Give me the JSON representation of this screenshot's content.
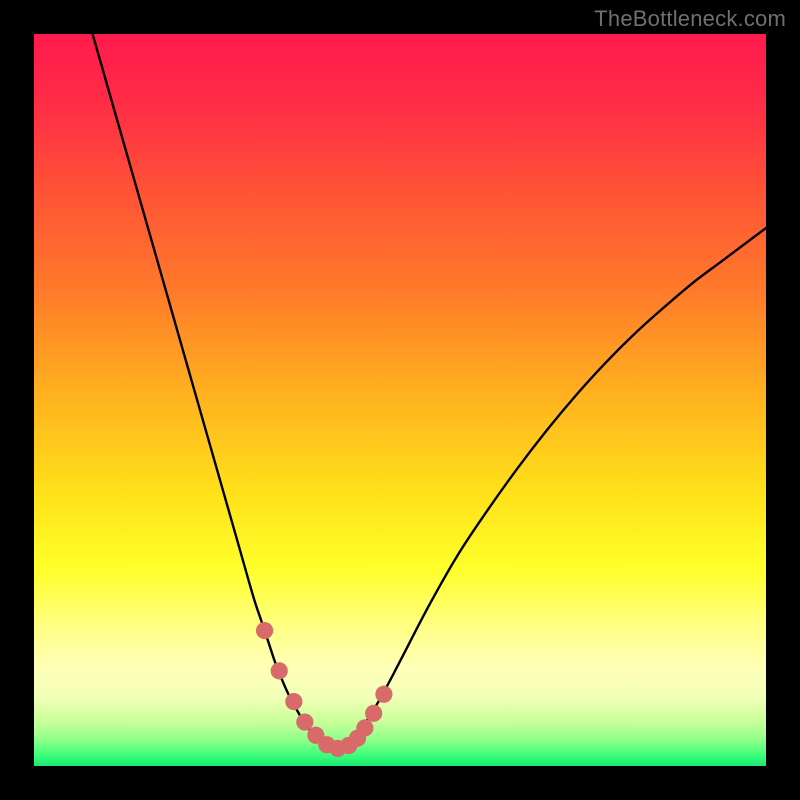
{
  "watermark": "TheBottleneck.com",
  "colors": {
    "bg_black": "#000000",
    "watermark": "#6f6f6f",
    "curve": "#000000",
    "marker_fill": "#d96a6a",
    "marker_stroke": "#c95858",
    "gradient_stops": [
      {
        "offset": 0.0,
        "color": "#ff1a4d"
      },
      {
        "offset": 0.1,
        "color": "#ff2e46"
      },
      {
        "offset": 0.22,
        "color": "#ff5436"
      },
      {
        "offset": 0.35,
        "color": "#ff7a2a"
      },
      {
        "offset": 0.5,
        "color": "#ffb41f"
      },
      {
        "offset": 0.63,
        "color": "#ffe21a"
      },
      {
        "offset": 0.73,
        "color": "#ffff2a"
      },
      {
        "offset": 0.815,
        "color": "#ffff8a"
      },
      {
        "offset": 0.865,
        "color": "#ffffb8"
      },
      {
        "offset": 0.905,
        "color": "#f3ffb8"
      },
      {
        "offset": 0.94,
        "color": "#c8ff9a"
      },
      {
        "offset": 0.965,
        "color": "#8dff8a"
      },
      {
        "offset": 0.985,
        "color": "#3dff7a"
      },
      {
        "offset": 1.0,
        "color": "#16e873"
      }
    ]
  },
  "chart_data": {
    "type": "line",
    "title": "",
    "xlabel": "",
    "ylabel": "",
    "xlim": [
      0,
      100
    ],
    "ylim": [
      0,
      100
    ],
    "series": [
      {
        "name": "bottleneck-curve",
        "x": [
          8,
          10,
          12,
          14,
          16,
          18,
          20,
          22,
          24,
          26,
          28,
          30,
          31,
          32,
          33,
          34,
          35,
          36,
          37,
          38,
          39,
          40,
          41,
          42,
          43,
          44,
          46,
          48,
          50,
          54,
          58,
          62,
          66,
          70,
          74,
          78,
          82,
          86,
          90,
          94,
          98,
          100
        ],
        "y": [
          100,
          93,
          86,
          79,
          72,
          65,
          58,
          51,
          44,
          37,
          30,
          23,
          20,
          17,
          14,
          11.5,
          9.3,
          7.5,
          5.8,
          4.5,
          3.5,
          2.8,
          2.4,
          2.6,
          3.2,
          4.2,
          7.0,
          10.5,
          14.3,
          22.0,
          29.0,
          35.0,
          40.6,
          45.8,
          50.6,
          55.0,
          59.0,
          62.6,
          66.0,
          69.0,
          72.0,
          73.5
        ]
      }
    ],
    "markers": {
      "name": "highlight-points",
      "x": [
        31.5,
        33.5,
        35.5,
        37.0,
        38.5,
        40.0,
        41.5,
        43.0,
        44.2,
        45.2,
        46.4,
        47.8
      ],
      "y": [
        18.5,
        13.0,
        8.8,
        6.0,
        4.2,
        2.9,
        2.4,
        2.8,
        3.8,
        5.2,
        7.2,
        9.8
      ],
      "radius": 8.6
    }
  }
}
